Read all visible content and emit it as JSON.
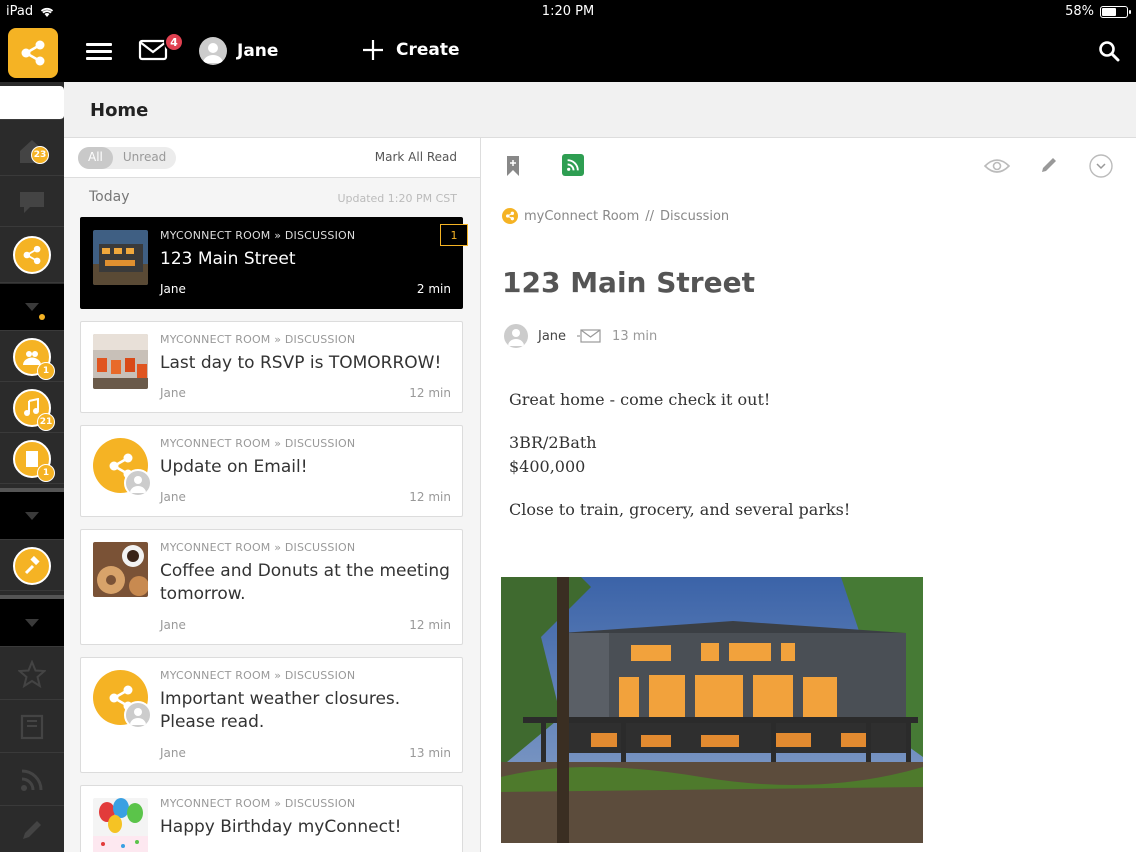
{
  "status": {
    "device": "iPad",
    "time": "1:20 PM",
    "battery": "58%",
    "battery_level": 0.58
  },
  "appbar": {
    "mail_count": "4",
    "user_name": "Jane",
    "create_label": "Create"
  },
  "rail": {
    "home_count": "23",
    "badges": [
      "1",
      "21",
      "1"
    ]
  },
  "page": {
    "title": "Home"
  },
  "list": {
    "filter_all": "All",
    "filter_unread": "Unread",
    "mark_all_read": "Mark All Read",
    "section": "Today",
    "updated": "Updated 1:20 PM CST",
    "items": [
      {
        "meta": "MYCONNECT ROOM » DISCUSSION",
        "title": "123 Main Street",
        "author": "Jane",
        "time": "2 min",
        "unread": "1"
      },
      {
        "meta": "MYCONNECT ROOM » DISCUSSION",
        "title": "Last day to RSVP is TOMORROW!",
        "author": "Jane",
        "time": "12 min"
      },
      {
        "meta": "MYCONNECT ROOM » DISCUSSION",
        "title": "Update on Email!",
        "author": "Jane",
        "time": "12 min"
      },
      {
        "meta": "MYCONNECT ROOM » DISCUSSION",
        "title": "Coffee and Donuts at the meeting tomorrow.",
        "author": "Jane",
        "time": "12 min"
      },
      {
        "meta": "MYCONNECT ROOM » DISCUSSION",
        "title": "Important weather closures. Please read.",
        "author": "Jane",
        "time": "13 min"
      },
      {
        "meta": "MYCONNECT ROOM » DISCUSSION",
        "title": "Happy Birthday myConnect!"
      }
    ]
  },
  "detail": {
    "room": "myConnect Room",
    "separator": "//",
    "section": "Discussion",
    "title": "123 Main Street",
    "author": "Jane",
    "time": "13 min",
    "line1": "Great home - come check it out!",
    "line2": "3BR/2Bath",
    "line3": "$400,000",
    "line4": "Close to train, grocery, and several parks!"
  },
  "colors": {
    "brand": "#f5b324",
    "badge": "#e04050",
    "rss": "#2e9e52"
  }
}
